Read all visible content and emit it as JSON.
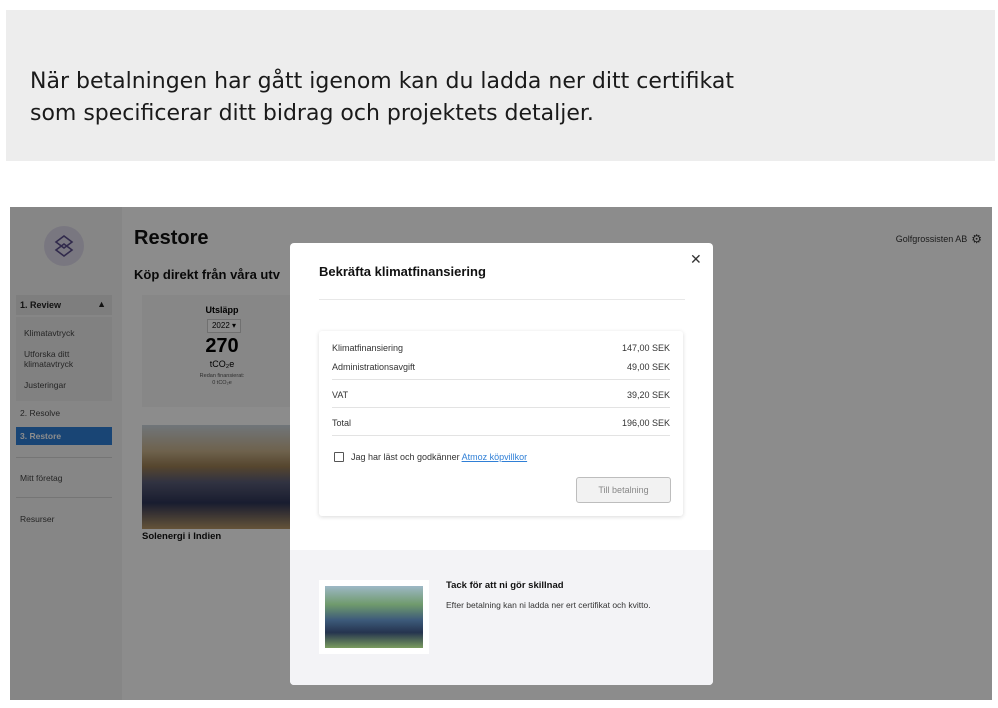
{
  "caption": {
    "line1": "När betalningen har gått igenom kan du ladda ner ditt certifikat",
    "line2": "som specificerar ditt bidrag och projektets detaljer."
  },
  "sidebar": {
    "section": "1. Review",
    "sub_items": [
      "Klimatavtryck",
      "Utforska ditt klimatavtryck",
      "Justeringar"
    ],
    "resolve": "2. Resolve",
    "restore": "3. Restore",
    "company": "Mitt företag",
    "resources": "Resurser"
  },
  "main": {
    "title": "Restore",
    "subtitle": "Köp direkt från våra utv",
    "org": "Golfgrossisten AB",
    "card": {
      "label": "Utsläpp",
      "year": "2022",
      "value": "270",
      "unit": "tCO₂e",
      "note1": "Redan finansierat:",
      "note2": "0 tCO₂e"
    },
    "project": "Solenergi i Indien"
  },
  "modal": {
    "title": "Bekräfta klimatfinansiering",
    "rows": [
      {
        "label": "Klimatfinansiering",
        "value": "147,00 SEK"
      },
      {
        "label": "Administrationsavgift",
        "value": "49,00 SEK"
      },
      {
        "label": "VAT",
        "value": "39,20 SEK"
      },
      {
        "label": "Total",
        "value": "196,00 SEK"
      }
    ],
    "terms_text": "Jag har läst och godkänner ",
    "terms_link": "Atmoz köpvillkor",
    "pay_button": "Till betalning",
    "thanks_title": "Tack för att ni gör skillnad",
    "thanks_text": "Efter betalning kan ni ladda ner ert certifikat och kvitto."
  }
}
